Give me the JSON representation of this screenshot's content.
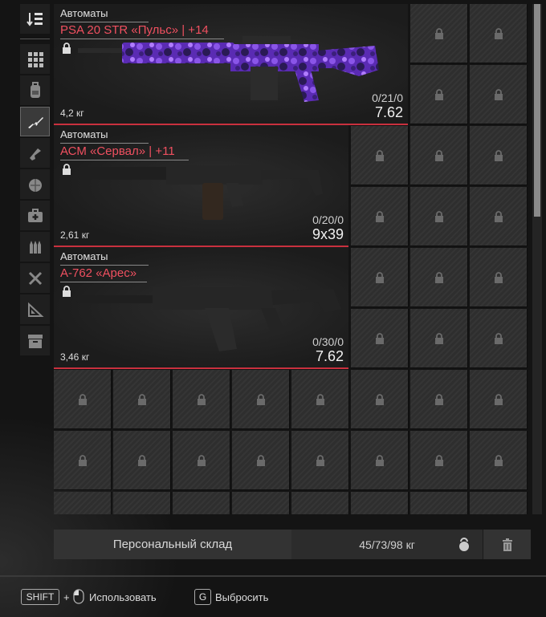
{
  "sidebar": {
    "items": [
      {
        "icon": "sort-icon",
        "active": false
      },
      {
        "icon": "grid-icon",
        "active": false
      },
      {
        "icon": "backpack-icon",
        "active": false
      },
      {
        "icon": "rifle-icon",
        "active": true
      },
      {
        "icon": "pistol-icon",
        "active": false
      },
      {
        "icon": "grenade-icon",
        "active": false
      },
      {
        "icon": "medkit-icon",
        "active": false
      },
      {
        "icon": "ammo-icon",
        "active": false
      },
      {
        "icon": "tools-icon",
        "active": false
      },
      {
        "icon": "ruler-icon",
        "active": false
      },
      {
        "icon": "archive-icon",
        "active": false
      }
    ]
  },
  "items": [
    {
      "category": "Автоматы",
      "name": "PSA 20 STR «Пульс» | +14",
      "weight": "4,2 кг",
      "ammo": "0/21/0",
      "caliber": "7.62",
      "skin": "purple-camo"
    },
    {
      "category": "Автоматы",
      "name": "АСМ «Сервал» | +11",
      "weight": "2,61 кг",
      "ammo": "0/20/0",
      "caliber": "9x39",
      "skin": "dark"
    },
    {
      "category": "Автоматы",
      "name": "А-762 «Арес»",
      "weight": "3,46 кг",
      "ammo": "0/30/0",
      "caliber": "7.62",
      "skin": "dark"
    }
  ],
  "storage": {
    "name": "Персональный склад",
    "weight": "45/73/98 кг"
  },
  "hints": {
    "shift_key": "SHIFT",
    "plus": "+",
    "use_label": "Использовать",
    "drop_key": "G",
    "drop_label": "Выбросить"
  },
  "colors": {
    "accent_red": "#c9303e",
    "name_red": "#f05060"
  }
}
